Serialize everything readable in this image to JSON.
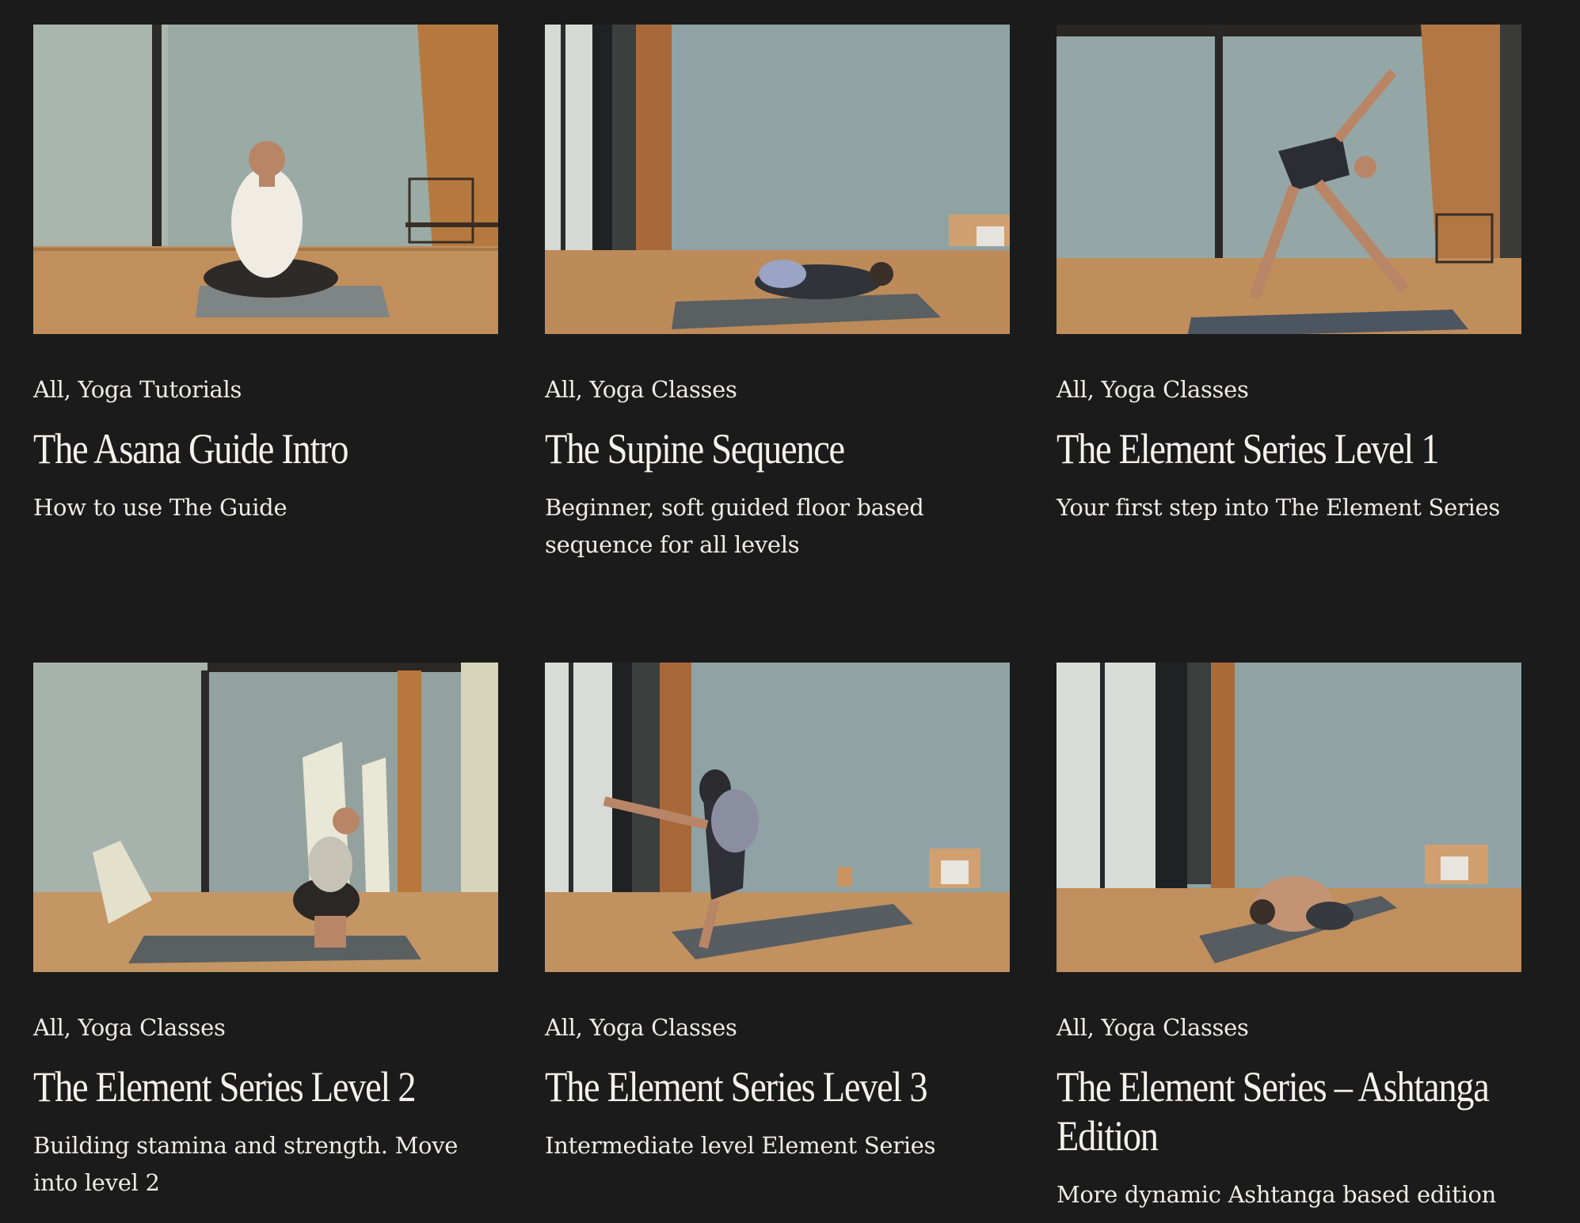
{
  "cards": [
    {
      "categories": "All, Yoga Tutorials",
      "title": "The Asana Guide Intro",
      "description": "How to use The Guide"
    },
    {
      "categories": "All, Yoga Classes",
      "title": "The Supine Sequence",
      "description": "Beginner, soft guided floor based sequence for all levels"
    },
    {
      "categories": "All, Yoga Classes",
      "title": "The Element Series Level 1",
      "description": "Your first step into The Element Series"
    },
    {
      "categories": "All, Yoga Classes",
      "title": "The Element Series Level 2",
      "description": "Building stamina and strength. Move into level 2"
    },
    {
      "categories": "All, Yoga Classes",
      "title": "The Element Series Level 3",
      "description": "Intermediate level Element Series"
    },
    {
      "categories": "All, Yoga Classes",
      "title": "The Element Series – Ashtanga Edition",
      "description": "More dynamic Ashtanga based edition"
    }
  ],
  "colors": {
    "background": "#1b1b1b",
    "text": "#f2f0ec",
    "wall": "#8fa3a2",
    "floor": "#b98a57",
    "wood": "#a8683a",
    "mat": "#4e5558"
  }
}
